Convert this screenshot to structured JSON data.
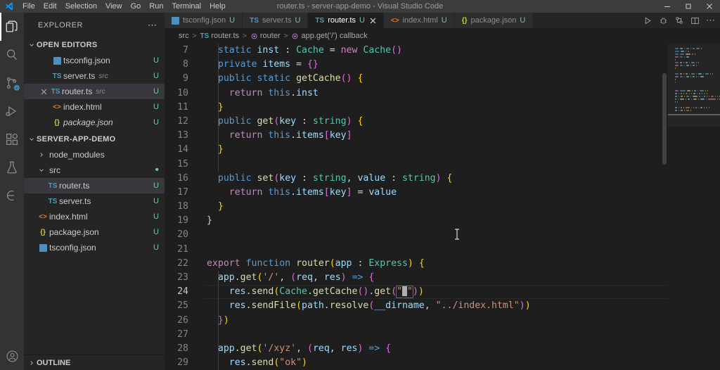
{
  "window": {
    "title": "router.ts - server-app-demo - Visual Studio Code",
    "logo_icon": "vscode-logo",
    "minimize_icon": "minimize-icon",
    "maximize_icon": "maximize-icon",
    "close_icon": "close-icon"
  },
  "menubar": {
    "items": [
      {
        "label": "File"
      },
      {
        "label": "Edit"
      },
      {
        "label": "Selection"
      },
      {
        "label": "View"
      },
      {
        "label": "Go"
      },
      {
        "label": "Run"
      },
      {
        "label": "Terminal"
      },
      {
        "label": "Help"
      }
    ]
  },
  "activitybar": {
    "items": [
      {
        "name": "explorer",
        "icon": "files-icon",
        "active": true,
        "badge": ""
      },
      {
        "name": "search",
        "icon": "search-icon",
        "active": false,
        "badge": ""
      },
      {
        "name": "source-control",
        "icon": "source-control-icon",
        "active": false,
        "badge": "sync"
      },
      {
        "name": "run-and-debug",
        "icon": "run-debug-icon",
        "active": false,
        "badge": ""
      },
      {
        "name": "extensions",
        "icon": "extensions-icon",
        "active": false,
        "badge": ""
      },
      {
        "name": "testing",
        "icon": "beaker-icon",
        "active": false,
        "badge": ""
      },
      {
        "name": "remote-explorer",
        "icon": "remote-icon",
        "active": false,
        "badge": ""
      }
    ],
    "bottom": [
      {
        "name": "accounts",
        "icon": "account-icon"
      }
    ]
  },
  "sidebar": {
    "title": "EXPLORER",
    "more_actions_icon": "ellipsis-icon",
    "open_editors": {
      "label": "OPEN EDITORS",
      "expanded": true,
      "items": [
        {
          "name": "tsconfig.json",
          "desc": "",
          "icon": "tsconfig-icon",
          "state": "U",
          "selected": false,
          "closable": false,
          "italic": false
        },
        {
          "name": "server.ts",
          "desc": "src",
          "icon": "ts-icon",
          "state": "U",
          "selected": false,
          "closable": false,
          "italic": false
        },
        {
          "name": "router.ts",
          "desc": "src",
          "icon": "ts-icon",
          "state": "U",
          "selected": true,
          "closable": true,
          "italic": false
        },
        {
          "name": "index.html",
          "desc": "",
          "icon": "html-icon",
          "state": "U",
          "selected": false,
          "closable": false,
          "italic": false
        },
        {
          "name": "package.json",
          "desc": "",
          "icon": "json-icon",
          "state": "U",
          "selected": false,
          "closable": false,
          "italic": true
        }
      ]
    },
    "workspace": {
      "label": "SERVER-APP-DEMO",
      "expanded": true,
      "items": [
        {
          "name": "node_modules",
          "type": "folder",
          "expanded": false,
          "depth": 1,
          "state": "",
          "selected": false,
          "icon": "folder-icon"
        },
        {
          "name": "src",
          "type": "folder",
          "expanded": true,
          "depth": 1,
          "state": "dot",
          "selected": false,
          "icon": "folder-open-icon"
        },
        {
          "name": "router.ts",
          "type": "file",
          "depth": 2,
          "state": "U",
          "selected": true,
          "icon": "ts-icon"
        },
        {
          "name": "server.ts",
          "type": "file",
          "depth": 2,
          "state": "U",
          "selected": false,
          "icon": "ts-icon"
        },
        {
          "name": "index.html",
          "type": "file",
          "depth": 1,
          "state": "U",
          "selected": false,
          "icon": "html-icon"
        },
        {
          "name": "package.json",
          "type": "file",
          "depth": 1,
          "state": "U",
          "selected": false,
          "icon": "json-icon"
        },
        {
          "name": "tsconfig.json",
          "type": "file",
          "depth": 1,
          "state": "U",
          "selected": false,
          "icon": "tsconfig-icon"
        }
      ]
    },
    "outline": {
      "label": "OUTLINE",
      "expanded": false
    }
  },
  "editor": {
    "tabs": [
      {
        "label": "tsconfig.json",
        "state": "U",
        "icon": "tsconfig-icon",
        "active": false,
        "closable": false
      },
      {
        "label": "server.ts",
        "state": "U",
        "icon": "ts-icon",
        "active": false,
        "closable": false
      },
      {
        "label": "router.ts",
        "state": "U",
        "icon": "ts-icon",
        "active": true,
        "closable": true
      },
      {
        "label": "index.html",
        "state": "U",
        "icon": "html-icon",
        "active": false,
        "closable": false
      },
      {
        "label": "package.json",
        "state": "U",
        "icon": "json-icon",
        "active": false,
        "closable": false
      }
    ],
    "actions": [
      {
        "name": "run-file",
        "icon": "play-icon"
      },
      {
        "name": "run-and-debug-file",
        "icon": "debug-alt-icon"
      },
      {
        "name": "open-changes",
        "icon": "compare-icon"
      },
      {
        "name": "split-editor-right",
        "icon": "split-editor-icon"
      },
      {
        "name": "more-actions",
        "icon": "ellipsis-icon"
      }
    ],
    "breadcrumb": [
      {
        "label": "src",
        "icon": ""
      },
      {
        "label": "router.ts",
        "icon": "ts-icon"
      },
      {
        "label": "router",
        "icon": "symbol-method-icon"
      },
      {
        "label": "app.get('/') callback",
        "icon": "symbol-method-icon"
      }
    ],
    "separator": ">",
    "cursor_line": 24,
    "lines": [
      {
        "num": 7,
        "tokens": [
          {
            "t": "  ",
            "c": "pu"
          },
          {
            "t": "static",
            "c": "kw"
          },
          {
            "t": " ",
            "c": "pu"
          },
          {
            "t": "inst",
            "c": "va"
          },
          {
            "t": " : ",
            "c": "pu"
          },
          {
            "t": "Cache",
            "c": "ty"
          },
          {
            "t": " = ",
            "c": "pu"
          },
          {
            "t": "new",
            "c": "k"
          },
          {
            "t": " ",
            "c": "pu"
          },
          {
            "t": "Cache",
            "c": "ty"
          },
          {
            "t": "()",
            "c": "pa"
          }
        ]
      },
      {
        "num": 8,
        "tokens": [
          {
            "t": "  ",
            "c": "pu"
          },
          {
            "t": "private",
            "c": "kw"
          },
          {
            "t": " ",
            "c": "pu"
          },
          {
            "t": "items",
            "c": "va"
          },
          {
            "t": " = ",
            "c": "pu"
          },
          {
            "t": "{}",
            "c": "pa"
          }
        ]
      },
      {
        "num": 9,
        "tokens": [
          {
            "t": "  ",
            "c": "pu"
          },
          {
            "t": "public",
            "c": "kw"
          },
          {
            "t": " ",
            "c": "pu"
          },
          {
            "t": "static",
            "c": "kw"
          },
          {
            "t": " ",
            "c": "pu"
          },
          {
            "t": "getCache",
            "c": "fn"
          },
          {
            "t": "()",
            "c": "pa"
          },
          {
            "t": " ",
            "c": "pu"
          },
          {
            "t": "{",
            "c": "pc"
          }
        ]
      },
      {
        "num": 10,
        "tokens": [
          {
            "t": "    ",
            "c": "pu"
          },
          {
            "t": "return",
            "c": "k"
          },
          {
            "t": " ",
            "c": "pu"
          },
          {
            "t": "this",
            "c": "kw"
          },
          {
            "t": ".",
            "c": "pu"
          },
          {
            "t": "inst",
            "c": "va"
          }
        ]
      },
      {
        "num": 11,
        "tokens": [
          {
            "t": "  ",
            "c": "pu"
          },
          {
            "t": "}",
            "c": "pc"
          }
        ]
      },
      {
        "num": 12,
        "tokens": [
          {
            "t": "  ",
            "c": "pu"
          },
          {
            "t": "public",
            "c": "kw"
          },
          {
            "t": " ",
            "c": "pu"
          },
          {
            "t": "get",
            "c": "fn"
          },
          {
            "t": "(",
            "c": "pa"
          },
          {
            "t": "key",
            "c": "va"
          },
          {
            "t": " : ",
            "c": "pu"
          },
          {
            "t": "string",
            "c": "ty"
          },
          {
            "t": ")",
            "c": "pa"
          },
          {
            "t": " ",
            "c": "pu"
          },
          {
            "t": "{",
            "c": "pc"
          }
        ]
      },
      {
        "num": 13,
        "tokens": [
          {
            "t": "    ",
            "c": "pu"
          },
          {
            "t": "return",
            "c": "k"
          },
          {
            "t": " ",
            "c": "pu"
          },
          {
            "t": "this",
            "c": "kw"
          },
          {
            "t": ".",
            "c": "pu"
          },
          {
            "t": "items",
            "c": "va"
          },
          {
            "t": "[",
            "c": "pa"
          },
          {
            "t": "key",
            "c": "va"
          },
          {
            "t": "]",
            "c": "pa"
          }
        ]
      },
      {
        "num": 14,
        "tokens": [
          {
            "t": "  ",
            "c": "pu"
          },
          {
            "t": "}",
            "c": "pc"
          }
        ]
      },
      {
        "num": 15,
        "tokens": []
      },
      {
        "num": 16,
        "tokens": [
          {
            "t": "  ",
            "c": "pu"
          },
          {
            "t": "public",
            "c": "kw"
          },
          {
            "t": " ",
            "c": "pu"
          },
          {
            "t": "set",
            "c": "fn"
          },
          {
            "t": "(",
            "c": "pa"
          },
          {
            "t": "key",
            "c": "va"
          },
          {
            "t": " : ",
            "c": "pu"
          },
          {
            "t": "string",
            "c": "ty"
          },
          {
            "t": ", ",
            "c": "pu"
          },
          {
            "t": "value",
            "c": "va"
          },
          {
            "t": " : ",
            "c": "pu"
          },
          {
            "t": "string",
            "c": "ty"
          },
          {
            "t": ")",
            "c": "pa"
          },
          {
            "t": " ",
            "c": "pu"
          },
          {
            "t": "{",
            "c": "pc"
          }
        ]
      },
      {
        "num": 17,
        "tokens": [
          {
            "t": "    ",
            "c": "pu"
          },
          {
            "t": "return",
            "c": "k"
          },
          {
            "t": " ",
            "c": "pu"
          },
          {
            "t": "this",
            "c": "kw"
          },
          {
            "t": ".",
            "c": "pu"
          },
          {
            "t": "items",
            "c": "va"
          },
          {
            "t": "[",
            "c": "pa"
          },
          {
            "t": "key",
            "c": "va"
          },
          {
            "t": "]",
            "c": "pa"
          },
          {
            "t": " = ",
            "c": "pu"
          },
          {
            "t": "value",
            "c": "va"
          }
        ]
      },
      {
        "num": 18,
        "tokens": [
          {
            "t": "  ",
            "c": "pu"
          },
          {
            "t": "}",
            "c": "pc"
          }
        ]
      },
      {
        "num": 19,
        "tokens": [
          {
            "t": "}",
            "c": "pu"
          }
        ]
      },
      {
        "num": 20,
        "tokens": []
      },
      {
        "num": 21,
        "tokens": []
      },
      {
        "num": 22,
        "tokens": [
          {
            "t": "export",
            "c": "k"
          },
          {
            "t": " ",
            "c": "pu"
          },
          {
            "t": "function",
            "c": "kw"
          },
          {
            "t": " ",
            "c": "pu"
          },
          {
            "t": "router",
            "c": "fn"
          },
          {
            "t": "(",
            "c": "pc"
          },
          {
            "t": "app",
            "c": "va"
          },
          {
            "t": " : ",
            "c": "pu"
          },
          {
            "t": "Express",
            "c": "ty"
          },
          {
            "t": ")",
            "c": "pc"
          },
          {
            "t": " ",
            "c": "pu"
          },
          {
            "t": "{",
            "c": "pc"
          }
        ]
      },
      {
        "num": 23,
        "tokens": [
          {
            "t": "  ",
            "c": "pu"
          },
          {
            "t": "app",
            "c": "va"
          },
          {
            "t": ".",
            "c": "pu"
          },
          {
            "t": "get",
            "c": "fn"
          },
          {
            "t": "(",
            "c": "pc"
          },
          {
            "t": "'/'",
            "c": "st"
          },
          {
            "t": ", ",
            "c": "pu"
          },
          {
            "t": "(",
            "c": "pa"
          },
          {
            "t": "req",
            "c": "va"
          },
          {
            "t": ", ",
            "c": "pu"
          },
          {
            "t": "res",
            "c": "va"
          },
          {
            "t": ")",
            "c": "pa"
          },
          {
            "t": " ",
            "c": "pu"
          },
          {
            "t": "=>",
            "c": "kw"
          },
          {
            "t": " ",
            "c": "pu"
          },
          {
            "t": "{",
            "c": "pa"
          }
        ]
      },
      {
        "num": 24,
        "tokens": [
          {
            "t": "    ",
            "c": "pu"
          },
          {
            "t": "res",
            "c": "va"
          },
          {
            "t": ".",
            "c": "pu"
          },
          {
            "t": "send",
            "c": "fn"
          },
          {
            "t": "(",
            "c": "pc"
          },
          {
            "t": "Cache",
            "c": "ty"
          },
          {
            "t": ".",
            "c": "pu"
          },
          {
            "t": "getCache",
            "c": "fn"
          },
          {
            "t": "()",
            "c": "pa"
          },
          {
            "t": ".",
            "c": "pu"
          },
          {
            "t": "get",
            "c": "fn"
          },
          {
            "t": "(",
            "c": "pa"
          },
          {
            "t": "\"",
            "c": "st"
          },
          {
            "t": "CARET",
            "c": "caret"
          },
          {
            "t": "\"",
            "c": "st"
          },
          {
            "t": ")",
            "c": "pa"
          },
          {
            "t": ")",
            "c": "pc"
          }
        ]
      },
      {
        "num": 25,
        "tokens": [
          {
            "t": "    ",
            "c": "pu"
          },
          {
            "t": "res",
            "c": "va"
          },
          {
            "t": ".",
            "c": "pu"
          },
          {
            "t": "sendFile",
            "c": "fn"
          },
          {
            "t": "(",
            "c": "pc"
          },
          {
            "t": "path",
            "c": "va"
          },
          {
            "t": ".",
            "c": "pu"
          },
          {
            "t": "resolve",
            "c": "fn"
          },
          {
            "t": "(",
            "c": "pa"
          },
          {
            "t": "__dirname",
            "c": "va"
          },
          {
            "t": ", ",
            "c": "pu"
          },
          {
            "t": "\"../index.html\"",
            "c": "st"
          },
          {
            "t": ")",
            "c": "pa"
          },
          {
            "t": ")",
            "c": "pc"
          }
        ]
      },
      {
        "num": 26,
        "tokens": [
          {
            "t": "  ",
            "c": "pu"
          },
          {
            "t": "}",
            "c": "pa"
          },
          {
            "t": ")",
            "c": "pc"
          }
        ]
      },
      {
        "num": 27,
        "tokens": []
      },
      {
        "num": 28,
        "tokens": [
          {
            "t": "  ",
            "c": "pu"
          },
          {
            "t": "app",
            "c": "va"
          },
          {
            "t": ".",
            "c": "pu"
          },
          {
            "t": "get",
            "c": "fn"
          },
          {
            "t": "(",
            "c": "pc"
          },
          {
            "t": "'/xyz'",
            "c": "st"
          },
          {
            "t": ", ",
            "c": "pu"
          },
          {
            "t": "(",
            "c": "pa"
          },
          {
            "t": "req",
            "c": "va"
          },
          {
            "t": ", ",
            "c": "pu"
          },
          {
            "t": "res",
            "c": "va"
          },
          {
            "t": ")",
            "c": "pa"
          },
          {
            "t": " ",
            "c": "pu"
          },
          {
            "t": "=>",
            "c": "kw"
          },
          {
            "t": " ",
            "c": "pu"
          },
          {
            "t": "{",
            "c": "pa"
          }
        ]
      },
      {
        "num": 29,
        "tokens": [
          {
            "t": "    ",
            "c": "pu"
          },
          {
            "t": "res",
            "c": "va"
          },
          {
            "t": ".",
            "c": "pu"
          },
          {
            "t": "send",
            "c": "fn"
          },
          {
            "t": "(",
            "c": "pc"
          },
          {
            "t": "\"ok\"",
            "c": "st"
          },
          {
            "t": ")",
            "c": "pc"
          }
        ]
      }
    ]
  },
  "colors": {
    "background": "#1e1e1e",
    "sidebar_bg": "#252526",
    "activitybar_bg": "#333333",
    "titlebar_bg": "#3c3c3c",
    "accent": "#007acc",
    "modified_badge": "#73c991",
    "selection_row": "#37373d"
  }
}
